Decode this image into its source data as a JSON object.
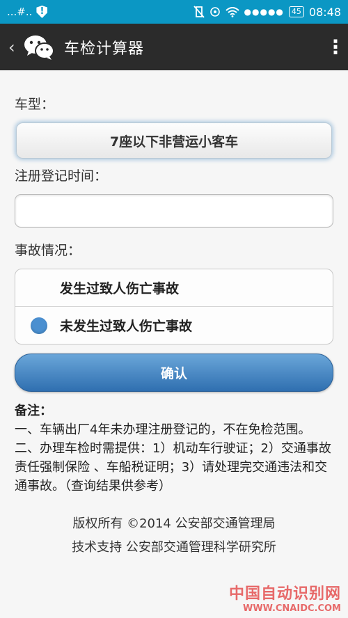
{
  "status_bar": {
    "left_text": "...#..",
    "battery": "45",
    "signal_dots": "●●●●●",
    "time": "08:48"
  },
  "title_bar": {
    "back": "‹",
    "title": "车检计算器",
    "more": "⋮"
  },
  "form": {
    "car_type_label": "车型：",
    "car_type_value": "7座以下非营运小客车",
    "reg_date_label": "注册登记时间：",
    "reg_date_value": "",
    "accident_label": "事故情况：",
    "accident_options": [
      {
        "label": "发生过致人伤亡事故",
        "selected": false
      },
      {
        "label": "未发生过致人伤亡事故",
        "selected": true
      }
    ],
    "confirm_label": "确认"
  },
  "notes": {
    "title": "备注：",
    "line1": "一、车辆出厂4年未办理注册登记的，不在免检范围。",
    "line2": "二、办理车检时需提供：1）机动车行驶证；2）交通事故责任强制保险 、车船税证明；3）请处理完交通违法和交通事故。（查询结果供参考）"
  },
  "footer": {
    "copyright": "版权所有 ©2014 公安部交通管理局",
    "support": "技术支持 公安部交通管理科学研究所"
  },
  "watermark": {
    "cn": "中国自动识别网",
    "en": "WWW.CNAIDC.COM"
  },
  "colors": {
    "status_bar": "#0b97c4",
    "title_bar": "#2b2b2b",
    "accent": "#4a8fd0",
    "confirm": "#3a7bbd"
  }
}
